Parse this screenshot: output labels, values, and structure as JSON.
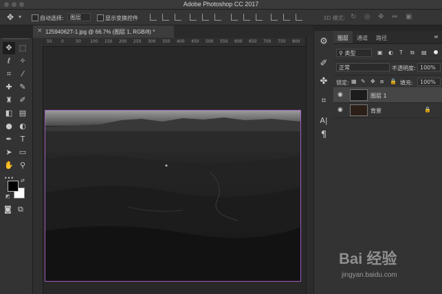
{
  "app": {
    "title": "Adobe Photoshop CC 2017"
  },
  "options_bar": {
    "auto_select_label": "自动选择:",
    "auto_select_value": "图层",
    "show_transform_label": "显示变换控件",
    "mode_3d_label": "3D 模式:"
  },
  "document": {
    "tab_title": "12594062T-1.jpg @ 66.7% (图层 1, RGB/8) *",
    "close_symbol": "×"
  },
  "ruler": {
    "top_ticks": [
      "50",
      "0",
      "50",
      "100",
      "150",
      "200",
      "250",
      "300",
      "350",
      "400",
      "450",
      "500",
      "550",
      "600",
      "650",
      "700",
      "750",
      "800"
    ]
  },
  "tools": [
    {
      "name": "move-tool",
      "glyph": "✥",
      "active": true
    },
    {
      "name": "marquee-tool",
      "glyph": "⬚",
      "active": false
    },
    {
      "name": "lasso-tool",
      "glyph": "ℓ",
      "active": false
    },
    {
      "name": "magic-wand-tool",
      "glyph": "✧",
      "active": false
    },
    {
      "name": "crop-tool",
      "glyph": "⌗",
      "active": false
    },
    {
      "name": "eyedropper-tool",
      "glyph": "⁄",
      "active": false
    },
    {
      "name": "healing-tool",
      "glyph": "✚",
      "active": false
    },
    {
      "name": "brush-tool",
      "glyph": "✎",
      "active": false
    },
    {
      "name": "stamp-tool",
      "glyph": "♜",
      "active": false
    },
    {
      "name": "history-brush-tool",
      "glyph": "✐",
      "active": false
    },
    {
      "name": "eraser-tool",
      "glyph": "◧",
      "active": false
    },
    {
      "name": "gradient-tool",
      "glyph": "▤",
      "active": false
    },
    {
      "name": "blur-tool",
      "glyph": "●",
      "active": false
    },
    {
      "name": "dodge-tool",
      "glyph": "◐",
      "active": false
    },
    {
      "name": "pen-tool",
      "glyph": "✒",
      "active": false
    },
    {
      "name": "type-tool",
      "glyph": "T",
      "active": false
    },
    {
      "name": "path-select-tool",
      "glyph": "➤",
      "active": false
    },
    {
      "name": "shape-tool",
      "glyph": "▭",
      "active": false
    },
    {
      "name": "hand-tool",
      "glyph": "✋",
      "active": false
    },
    {
      "name": "zoom-tool",
      "glyph": "⚲",
      "active": false
    },
    {
      "name": "more-tools",
      "glyph": "•••",
      "active": false
    }
  ],
  "colors": {
    "foreground": "#000000",
    "background": "#ffffff",
    "selection_border": "#a35bc0"
  },
  "panel": {
    "tabs": [
      "图层",
      "通道",
      "路径"
    ],
    "filter_kind": "类型",
    "blend_mode": "正常",
    "opacity_label": "不透明度:",
    "opacity_value": "100%",
    "lock_label": "锁定:",
    "fill_label": "填充:",
    "fill_value": "100%",
    "layers": [
      {
        "name": "图层 1",
        "selected": true,
        "visible": true,
        "locked": false
      },
      {
        "name": "背景",
        "selected": false,
        "visible": true,
        "locked": true
      }
    ]
  },
  "watermark": {
    "brand": "Bai 经验",
    "url": "jingyan.baidu.com"
  }
}
